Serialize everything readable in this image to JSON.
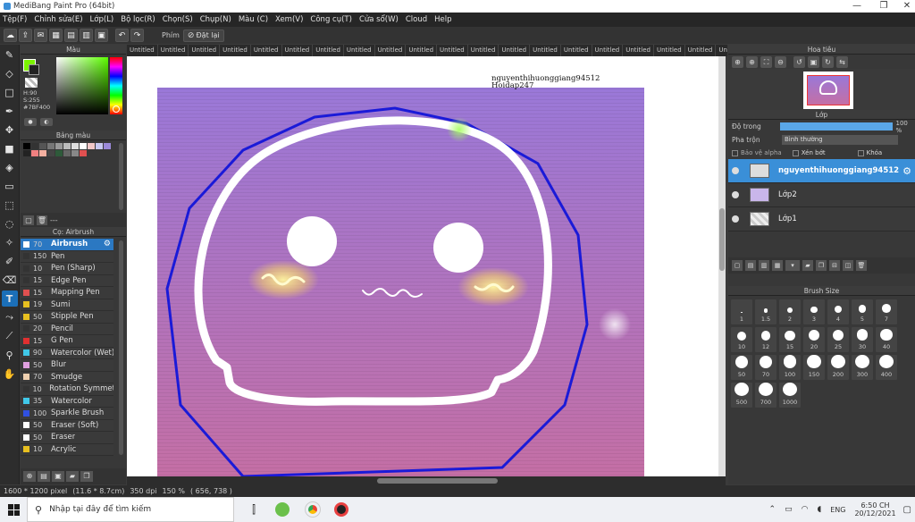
{
  "window": {
    "title": "MediBang Paint Pro (64bit)"
  },
  "menu": [
    "Tệp(F)",
    "Chỉnh sửa(E)",
    "Lớp(L)",
    "Bộ lọc(R)",
    "Chọn(S)",
    "Chụp(N)",
    "Màu (C)",
    "Xem(V)",
    "Công cụ(T)",
    "Cửa sổ(W)",
    "Cloud",
    "Help"
  ],
  "toolbar": {
    "shortcut_label": "Phím",
    "reset_label": "Đặt lại"
  },
  "color_panel": {
    "title": "Màu",
    "h": "H:90",
    "s": "S:255",
    "hex": "#7BF400",
    "current_color": "#7bf400"
  },
  "palette_panel": {
    "title": "Bảng màu",
    "more": "---"
  },
  "brush_panel": {
    "title": "Cọ: Airbrush",
    "brushes": [
      {
        "size": "70",
        "name": "Airbrush",
        "color": "#ffffff"
      },
      {
        "size": "150",
        "name": "Pen",
        "color": "#333333"
      },
      {
        "size": "10",
        "name": "Pen (Sharp)",
        "color": "#333333"
      },
      {
        "size": "15",
        "name": "Edge Pen",
        "color": "#333333"
      },
      {
        "size": "15",
        "name": "Mapping Pen",
        "color": "#e05050"
      },
      {
        "size": "19",
        "name": "Sumi",
        "color": "#e8c020"
      },
      {
        "size": "50",
        "name": "Stipple Pen",
        "color": "#e8c020"
      },
      {
        "size": "20",
        "name": "Pencil",
        "color": "#333333"
      },
      {
        "size": "15",
        "name": "G Pen",
        "color": "#e03030"
      },
      {
        "size": "90",
        "name": "Watercolor (Wet)",
        "color": "#40c8e8"
      },
      {
        "size": "50",
        "name": "Blur",
        "color": "#e0a0e0"
      },
      {
        "size": "70",
        "name": "Smudge",
        "color": "#f0d0b0"
      },
      {
        "size": "10",
        "name": "Rotation Symmetr",
        "color": "#333333"
      },
      {
        "size": "35",
        "name": "Watercolor",
        "color": "#40c8e8"
      },
      {
        "size": "100",
        "name": "Sparkle Brush",
        "color": "#3050e0"
      },
      {
        "size": "50",
        "name": "Eraser (Soft)",
        "color": "#ffffff"
      },
      {
        "size": "50",
        "name": "Eraser",
        "color": "#ffffff"
      },
      {
        "size": "10",
        "name": "Acrylic",
        "color": "#e8c020"
      }
    ]
  },
  "tabs": [
    "Untitled",
    "Untitled",
    "Untitled",
    "Untitled",
    "Untitled",
    "Untitled",
    "Untitled",
    "Untitled",
    "Untitled",
    "Untitled",
    "Untitled",
    "Untitled",
    "Untitled",
    "Untitled",
    "Untitled",
    "Untitled",
    "Untitled",
    "Untitled",
    "Untitled",
    "Untitled",
    "Untitled",
    "Untitled"
  ],
  "canvas": {
    "watermark_line1": "nguyenthihuonggiang94512",
    "watermark_line2": "Hoidap247"
  },
  "navigator": {
    "title": "Hoa tiêu"
  },
  "layers": {
    "title": "Lớp",
    "opacity_label": "Độ trong",
    "opacity_value": "100 %",
    "opacity_fraction": 1.0,
    "blend_label": "Pha trộn",
    "blend_value": "Bình thường",
    "protect_alpha": "Bảo vệ alpha",
    "clipping": "Xén bớt",
    "lock": "Khóa",
    "items": [
      {
        "name": "nguyenthihuonggiang94512",
        "selected": true
      },
      {
        "name": "Lớp2",
        "selected": false
      },
      {
        "name": "Lớp1",
        "selected": false
      }
    ]
  },
  "brush_size": {
    "title": "Brush Size",
    "sizes": [
      "1",
      "1.5",
      "2",
      "3",
      "4",
      "5",
      "7",
      "10",
      "12",
      "15",
      "20",
      "25",
      "30",
      "40",
      "50",
      "70",
      "100",
      "150",
      "200",
      "300",
      "400",
      "500",
      "700",
      "1000"
    ]
  },
  "status": {
    "dimensions": "1600 * 1200 pixel",
    "physical": "(11.6 * 8.7cm)",
    "dpi": "350 dpi",
    "zoom": "150 %",
    "coords": "( 656, 738 )"
  },
  "taskbar": {
    "search_placeholder": "Nhập tại đây để tìm kiếm",
    "lang": "ENG",
    "time": "6:50 CH",
    "date": "20/12/2021"
  }
}
